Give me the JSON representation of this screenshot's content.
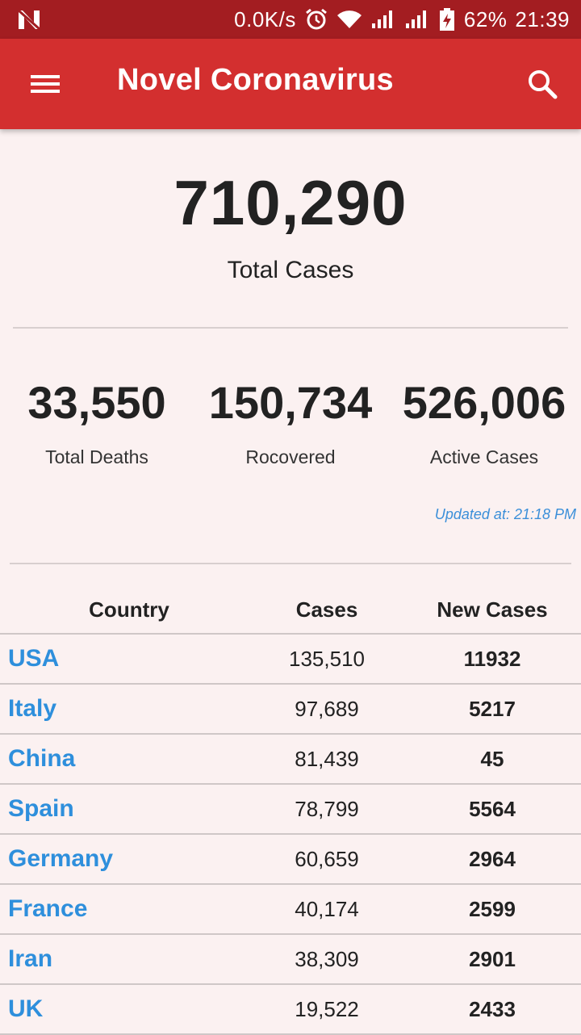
{
  "status_bar": {
    "network_speed": "0.0K/s",
    "battery": "62%",
    "time": "21:39",
    "icons": [
      "notification-n-icon",
      "alarm-icon",
      "wifi-icon",
      "signal-icon",
      "signal-icon",
      "battery-charging-icon"
    ]
  },
  "app_bar": {
    "title": "Novel Coronavirus",
    "menu_icon": "menu-icon",
    "search_icon": "search-icon",
    "color": "#d32f2f"
  },
  "summary": {
    "total_cases": "710,290",
    "total_cases_label": "Total Cases",
    "deaths": "33,550",
    "deaths_label": "Total Deaths",
    "recovered": "150,734",
    "recovered_label": "Rocovered",
    "active": "526,006",
    "active_label": "Active Cases",
    "updated": "Updated at: 21:18 PM"
  },
  "table": {
    "headers": [
      "Country",
      "Cases",
      "New Cases"
    ],
    "rows": [
      {
        "country": "USA",
        "cases": "135,510",
        "new_cases": "11932"
      },
      {
        "country": "Italy",
        "cases": "97,689",
        "new_cases": "5217"
      },
      {
        "country": "China",
        "cases": "81,439",
        "new_cases": "45"
      },
      {
        "country": "Spain",
        "cases": "78,799",
        "new_cases": "5564"
      },
      {
        "country": "Germany",
        "cases": "60,659",
        "new_cases": "2964"
      },
      {
        "country": "France",
        "cases": "40,174",
        "new_cases": "2599"
      },
      {
        "country": "Iran",
        "cases": "38,309",
        "new_cases": "2901"
      },
      {
        "country": "UK",
        "cases": "19,522",
        "new_cases": "2433"
      }
    ]
  },
  "colors": {
    "status_bar": "#a31d21",
    "background": "#fbf1f1",
    "link": "#2e8fdc"
  }
}
